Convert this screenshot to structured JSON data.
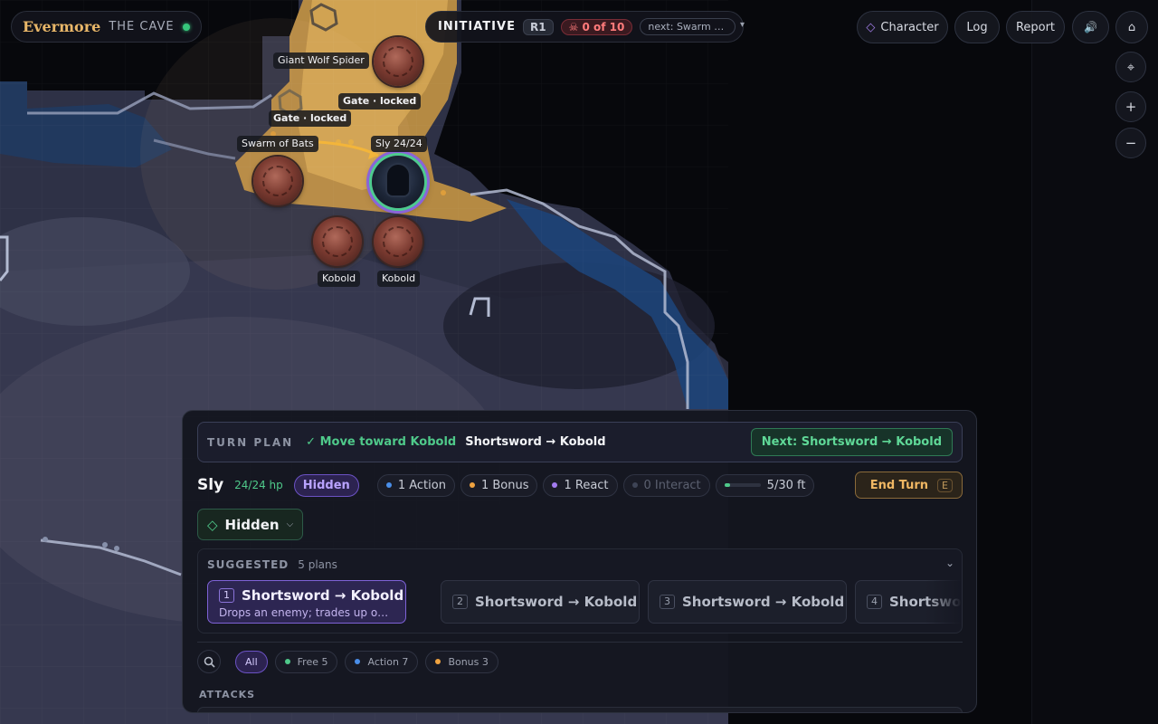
{
  "app": {
    "name": "Evermore",
    "location": "THE CAVE",
    "connection_color": "#36c77b"
  },
  "initiative": {
    "label": "INITIATIVE",
    "round": "R1",
    "defeated": "☠ 0 of 10",
    "next": "next: Swarm of ...",
    "caret": "▾"
  },
  "toolbar": {
    "character": "Character",
    "character_icon": "◇",
    "log": "Log",
    "report": "Report",
    "sound_icon": "🔊",
    "home_icon": "⌂"
  },
  "map_controls": {
    "recenter": "⌖",
    "zoom_in": "+",
    "zoom_out": "−"
  },
  "map": {
    "labels": {
      "spider": "Giant Wolf Spider",
      "gate1": "Gate · locked",
      "gate2": "Gate · locked",
      "bats": "Swarm of Bats",
      "player": "Sly 24/24",
      "kobold1": "Kobold",
      "kobold2": "Kobold"
    }
  },
  "turn_plan": {
    "label": "TURN PLAN",
    "completed": "✓ Move toward Kobold",
    "current": "Shortsword → Kobold",
    "next_button": "Next: Shortsword → Kobold"
  },
  "character": {
    "name": "Sly",
    "hp": "24/24 hp",
    "condition": "Hidden",
    "resources": [
      {
        "label": "1 Action",
        "color": "#4a8ee8",
        "available": true
      },
      {
        "label": "1 Bonus",
        "color": "#f0a340",
        "available": true
      },
      {
        "label": "1 React",
        "color": "#a37cf0",
        "available": true
      },
      {
        "label": "0 Interact",
        "color": "#3e4456",
        "available": false
      }
    ],
    "movement": {
      "label": "5/30 ft",
      "fraction": 0.167
    },
    "end_turn": "End Turn",
    "end_turn_key": "E"
  },
  "stance": {
    "icon": "◇",
    "label": "Hidden",
    "caret": "⌵"
  },
  "suggested": {
    "title": "SUGGESTED",
    "count": "5 plans",
    "toggle": "⌄",
    "plans": [
      {
        "num": "1",
        "title": "Shortsword → Kobold",
        "desc": "Drops an enemy; trades up on health; g..."
      },
      {
        "num": "2",
        "title": "Shortsword → Kobold"
      },
      {
        "num": "3",
        "title": "Shortsword → Kobold"
      },
      {
        "num": "4",
        "title": "Shortsword → Kobold"
      }
    ]
  },
  "filters": [
    {
      "label": "All",
      "active": true
    },
    {
      "label": "Free 5",
      "color": "#4fc98a"
    },
    {
      "label": "Action 7",
      "color": "#4a8ee8"
    },
    {
      "label": "Bonus 3",
      "color": "#f0a340"
    }
  ],
  "section": {
    "attacks": "ATTACKS"
  }
}
